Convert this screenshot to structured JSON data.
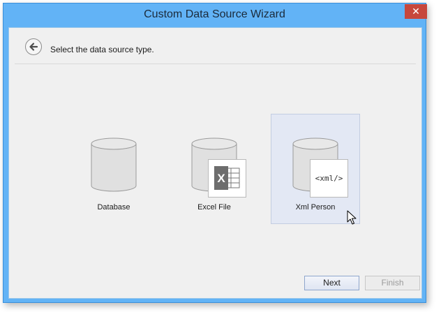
{
  "window": {
    "title": "Custom Data Source Wizard",
    "close_glyph": "✕"
  },
  "header": {
    "instruction": "Select the data source type.",
    "back_icon": "arrow-left-icon"
  },
  "tiles": [
    {
      "label": "Database",
      "icon": "database-icon",
      "selected": false
    },
    {
      "label": "Excel File",
      "icon": "excel-file-icon",
      "selected": false,
      "overlay_text": "X"
    },
    {
      "label": "Xml Person",
      "icon": "xml-file-icon",
      "selected": true,
      "overlay_text": "<xml/>"
    }
  ],
  "buttons": {
    "next": "Next",
    "finish": "Finish",
    "finish_enabled": false
  },
  "colors": {
    "titlebar": "#62b3f6",
    "close": "#c7473c",
    "client": "#f0f0f0",
    "selected_tile": "#e3e8f4"
  }
}
